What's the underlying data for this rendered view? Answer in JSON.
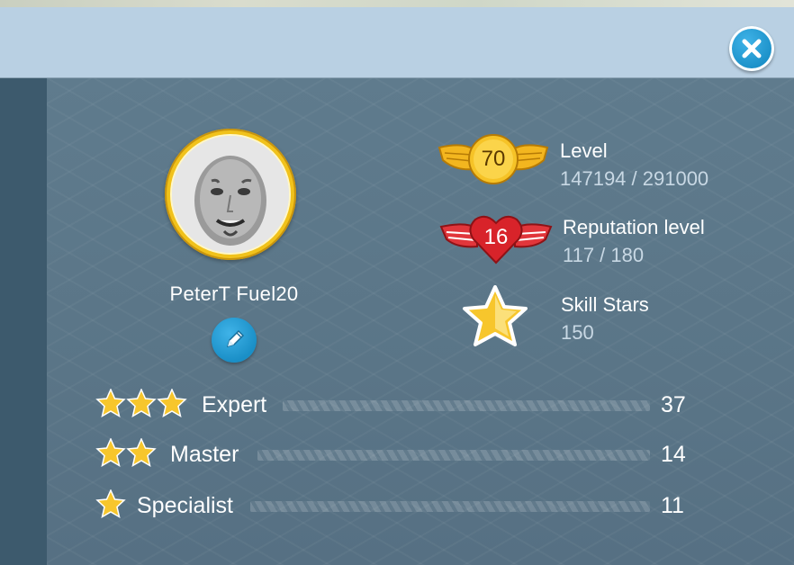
{
  "profile": {
    "username": "PeterT Fuel20"
  },
  "stats": {
    "level": {
      "badge": "70",
      "title": "Level",
      "value": "147194 / 291000"
    },
    "reputation": {
      "badge": "16",
      "title": "Reputation level",
      "value": "117 / 180"
    },
    "skill_stars": {
      "title": "Skill Stars",
      "value": "150"
    }
  },
  "ranks": [
    {
      "label": "Expert",
      "stars": 3,
      "count": "37"
    },
    {
      "label": "Master",
      "stars": 2,
      "count": "14"
    },
    {
      "label": "Specialist",
      "stars": 1,
      "count": "11"
    }
  ],
  "icons": {
    "close": "close-icon",
    "edit": "pencil-icon",
    "level_badge": "winged-shield-icon",
    "reputation_badge": "winged-heart-icon",
    "skill": "star-icon"
  },
  "colors": {
    "header_bg": "#b9d0e3",
    "panel_bg": "#5f7b8d",
    "accent_blue": "#1a8fc7",
    "gold": "#f1c21b",
    "reputation_red": "#d8232a"
  }
}
